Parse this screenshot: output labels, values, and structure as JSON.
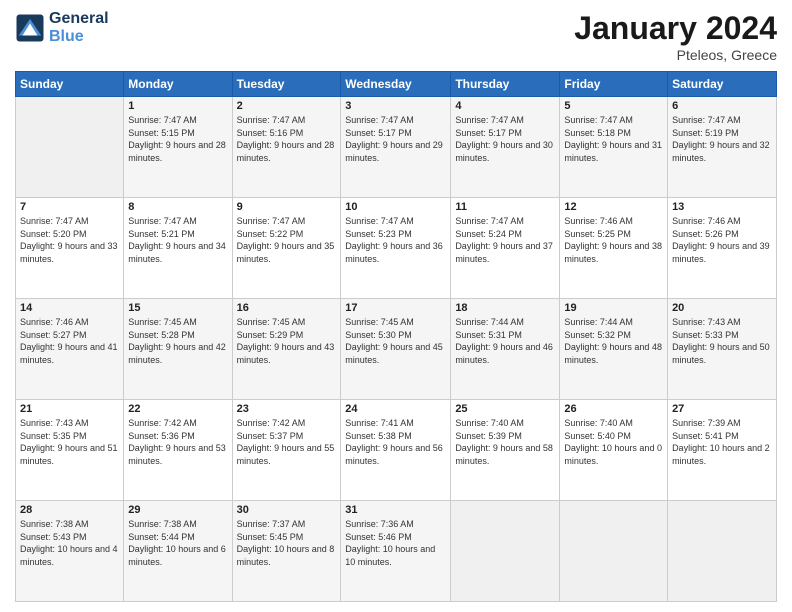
{
  "header": {
    "logo_line1": "General",
    "logo_line2": "Blue",
    "title": "January 2024",
    "subtitle": "Pteleos, Greece"
  },
  "weekdays": [
    "Sunday",
    "Monday",
    "Tuesday",
    "Wednesday",
    "Thursday",
    "Friday",
    "Saturday"
  ],
  "weeks": [
    [
      {
        "day": "",
        "sunrise": "",
        "sunset": "",
        "daylight": ""
      },
      {
        "day": "1",
        "sunrise": "Sunrise: 7:47 AM",
        "sunset": "Sunset: 5:15 PM",
        "daylight": "Daylight: 9 hours and 28 minutes."
      },
      {
        "day": "2",
        "sunrise": "Sunrise: 7:47 AM",
        "sunset": "Sunset: 5:16 PM",
        "daylight": "Daylight: 9 hours and 28 minutes."
      },
      {
        "day": "3",
        "sunrise": "Sunrise: 7:47 AM",
        "sunset": "Sunset: 5:17 PM",
        "daylight": "Daylight: 9 hours and 29 minutes."
      },
      {
        "day": "4",
        "sunrise": "Sunrise: 7:47 AM",
        "sunset": "Sunset: 5:17 PM",
        "daylight": "Daylight: 9 hours and 30 minutes."
      },
      {
        "day": "5",
        "sunrise": "Sunrise: 7:47 AM",
        "sunset": "Sunset: 5:18 PM",
        "daylight": "Daylight: 9 hours and 31 minutes."
      },
      {
        "day": "6",
        "sunrise": "Sunrise: 7:47 AM",
        "sunset": "Sunset: 5:19 PM",
        "daylight": "Daylight: 9 hours and 32 minutes."
      }
    ],
    [
      {
        "day": "7",
        "sunrise": "Sunrise: 7:47 AM",
        "sunset": "Sunset: 5:20 PM",
        "daylight": "Daylight: 9 hours and 33 minutes."
      },
      {
        "day": "8",
        "sunrise": "Sunrise: 7:47 AM",
        "sunset": "Sunset: 5:21 PM",
        "daylight": "Daylight: 9 hours and 34 minutes."
      },
      {
        "day": "9",
        "sunrise": "Sunrise: 7:47 AM",
        "sunset": "Sunset: 5:22 PM",
        "daylight": "Daylight: 9 hours and 35 minutes."
      },
      {
        "day": "10",
        "sunrise": "Sunrise: 7:47 AM",
        "sunset": "Sunset: 5:23 PM",
        "daylight": "Daylight: 9 hours and 36 minutes."
      },
      {
        "day": "11",
        "sunrise": "Sunrise: 7:47 AM",
        "sunset": "Sunset: 5:24 PM",
        "daylight": "Daylight: 9 hours and 37 minutes."
      },
      {
        "day": "12",
        "sunrise": "Sunrise: 7:46 AM",
        "sunset": "Sunset: 5:25 PM",
        "daylight": "Daylight: 9 hours and 38 minutes."
      },
      {
        "day": "13",
        "sunrise": "Sunrise: 7:46 AM",
        "sunset": "Sunset: 5:26 PM",
        "daylight": "Daylight: 9 hours and 39 minutes."
      }
    ],
    [
      {
        "day": "14",
        "sunrise": "Sunrise: 7:46 AM",
        "sunset": "Sunset: 5:27 PM",
        "daylight": "Daylight: 9 hours and 41 minutes."
      },
      {
        "day": "15",
        "sunrise": "Sunrise: 7:45 AM",
        "sunset": "Sunset: 5:28 PM",
        "daylight": "Daylight: 9 hours and 42 minutes."
      },
      {
        "day": "16",
        "sunrise": "Sunrise: 7:45 AM",
        "sunset": "Sunset: 5:29 PM",
        "daylight": "Daylight: 9 hours and 43 minutes."
      },
      {
        "day": "17",
        "sunrise": "Sunrise: 7:45 AM",
        "sunset": "Sunset: 5:30 PM",
        "daylight": "Daylight: 9 hours and 45 minutes."
      },
      {
        "day": "18",
        "sunrise": "Sunrise: 7:44 AM",
        "sunset": "Sunset: 5:31 PM",
        "daylight": "Daylight: 9 hours and 46 minutes."
      },
      {
        "day": "19",
        "sunrise": "Sunrise: 7:44 AM",
        "sunset": "Sunset: 5:32 PM",
        "daylight": "Daylight: 9 hours and 48 minutes."
      },
      {
        "day": "20",
        "sunrise": "Sunrise: 7:43 AM",
        "sunset": "Sunset: 5:33 PM",
        "daylight": "Daylight: 9 hours and 50 minutes."
      }
    ],
    [
      {
        "day": "21",
        "sunrise": "Sunrise: 7:43 AM",
        "sunset": "Sunset: 5:35 PM",
        "daylight": "Daylight: 9 hours and 51 minutes."
      },
      {
        "day": "22",
        "sunrise": "Sunrise: 7:42 AM",
        "sunset": "Sunset: 5:36 PM",
        "daylight": "Daylight: 9 hours and 53 minutes."
      },
      {
        "day": "23",
        "sunrise": "Sunrise: 7:42 AM",
        "sunset": "Sunset: 5:37 PM",
        "daylight": "Daylight: 9 hours and 55 minutes."
      },
      {
        "day": "24",
        "sunrise": "Sunrise: 7:41 AM",
        "sunset": "Sunset: 5:38 PM",
        "daylight": "Daylight: 9 hours and 56 minutes."
      },
      {
        "day": "25",
        "sunrise": "Sunrise: 7:40 AM",
        "sunset": "Sunset: 5:39 PM",
        "daylight": "Daylight: 9 hours and 58 minutes."
      },
      {
        "day": "26",
        "sunrise": "Sunrise: 7:40 AM",
        "sunset": "Sunset: 5:40 PM",
        "daylight": "Daylight: 10 hours and 0 minutes."
      },
      {
        "day": "27",
        "sunrise": "Sunrise: 7:39 AM",
        "sunset": "Sunset: 5:41 PM",
        "daylight": "Daylight: 10 hours and 2 minutes."
      }
    ],
    [
      {
        "day": "28",
        "sunrise": "Sunrise: 7:38 AM",
        "sunset": "Sunset: 5:43 PM",
        "daylight": "Daylight: 10 hours and 4 minutes."
      },
      {
        "day": "29",
        "sunrise": "Sunrise: 7:38 AM",
        "sunset": "Sunset: 5:44 PM",
        "daylight": "Daylight: 10 hours and 6 minutes."
      },
      {
        "day": "30",
        "sunrise": "Sunrise: 7:37 AM",
        "sunset": "Sunset: 5:45 PM",
        "daylight": "Daylight: 10 hours and 8 minutes."
      },
      {
        "day": "31",
        "sunrise": "Sunrise: 7:36 AM",
        "sunset": "Sunset: 5:46 PM",
        "daylight": "Daylight: 10 hours and 10 minutes."
      },
      {
        "day": "",
        "sunrise": "",
        "sunset": "",
        "daylight": ""
      },
      {
        "day": "",
        "sunrise": "",
        "sunset": "",
        "daylight": ""
      },
      {
        "day": "",
        "sunrise": "",
        "sunset": "",
        "daylight": ""
      }
    ]
  ]
}
